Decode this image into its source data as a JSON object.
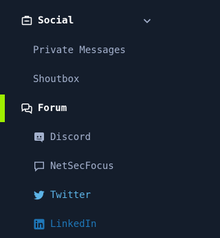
{
  "sidebar": {
    "social": {
      "label": "Social",
      "icon": "social-id-card-icon",
      "toggle_icon": "chevron-down-icon"
    },
    "items": [
      {
        "label": "Private Messages"
      },
      {
        "label": "Shoutbox"
      }
    ],
    "forum": {
      "label": "Forum",
      "icon": "chat-bubbles-icon",
      "active": true,
      "active_color": "#9fef00"
    },
    "links": [
      {
        "label": "Discord",
        "icon": "discord-icon",
        "color": "#a4b1cd"
      },
      {
        "label": "NetSecFocus",
        "icon": "chat-bubble-icon",
        "color": "#a4b1cd"
      },
      {
        "label": "Twitter",
        "icon": "twitter-icon",
        "color": "#5cb3e6"
      },
      {
        "label": "LinkedIn",
        "icon": "linkedin-icon",
        "color": "#1f78b9"
      }
    ]
  },
  "colors": {
    "background": "#141d2b",
    "text_primary": "#ffffff",
    "text_secondary": "#a4b1cd",
    "accent": "#9fef00"
  }
}
